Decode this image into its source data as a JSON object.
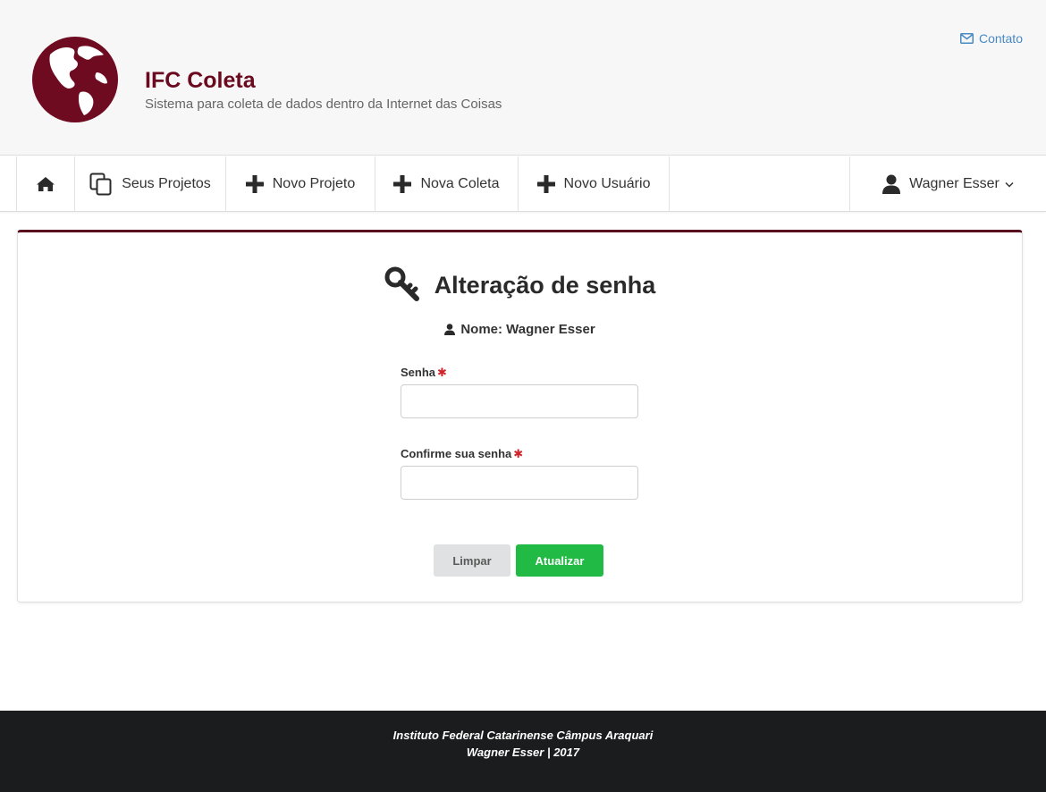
{
  "header": {
    "logo": "globe-logo",
    "title": "IFC Coleta",
    "subtitle": "Sistema para coleta de dados dentro da Internet das Coisas",
    "contact_label": "Contato",
    "contact_icon": "envelope-icon"
  },
  "nav": {
    "items": [
      {
        "icon": "home-icon",
        "label": ""
      },
      {
        "icon": "copy-icon",
        "label": "Seus Projetos"
      },
      {
        "icon": "plus-icon",
        "label": "Novo Projeto"
      },
      {
        "icon": "plus-icon",
        "label": "Nova Coleta"
      },
      {
        "icon": "plus-icon",
        "label": "Novo Usuário"
      }
    ],
    "user": {
      "icon": "user-icon",
      "label": "Wagner Esser"
    }
  },
  "form": {
    "title": "Alteração de senha",
    "title_icon": "key-icon",
    "name_label": "Nome: Wagner Esser",
    "password_label": "Senha",
    "password_value": "",
    "confirm_label": "Confirme sua senha",
    "confirm_value": "",
    "required_marker": "✱",
    "clear_button": "Limpar",
    "update_button": "Atualizar"
  },
  "footer": {
    "line1": "Instituto Federal Catarinense Câmpus Araquari",
    "line2": "Wagner Esser | 2017"
  },
  "colors": {
    "brand": "#6b0a1e",
    "card_top": "#5a0f1f",
    "link": "#4a8ac4",
    "success": "#21ba45",
    "required": "#d0232a",
    "footer_bg": "#1b1c1d"
  }
}
